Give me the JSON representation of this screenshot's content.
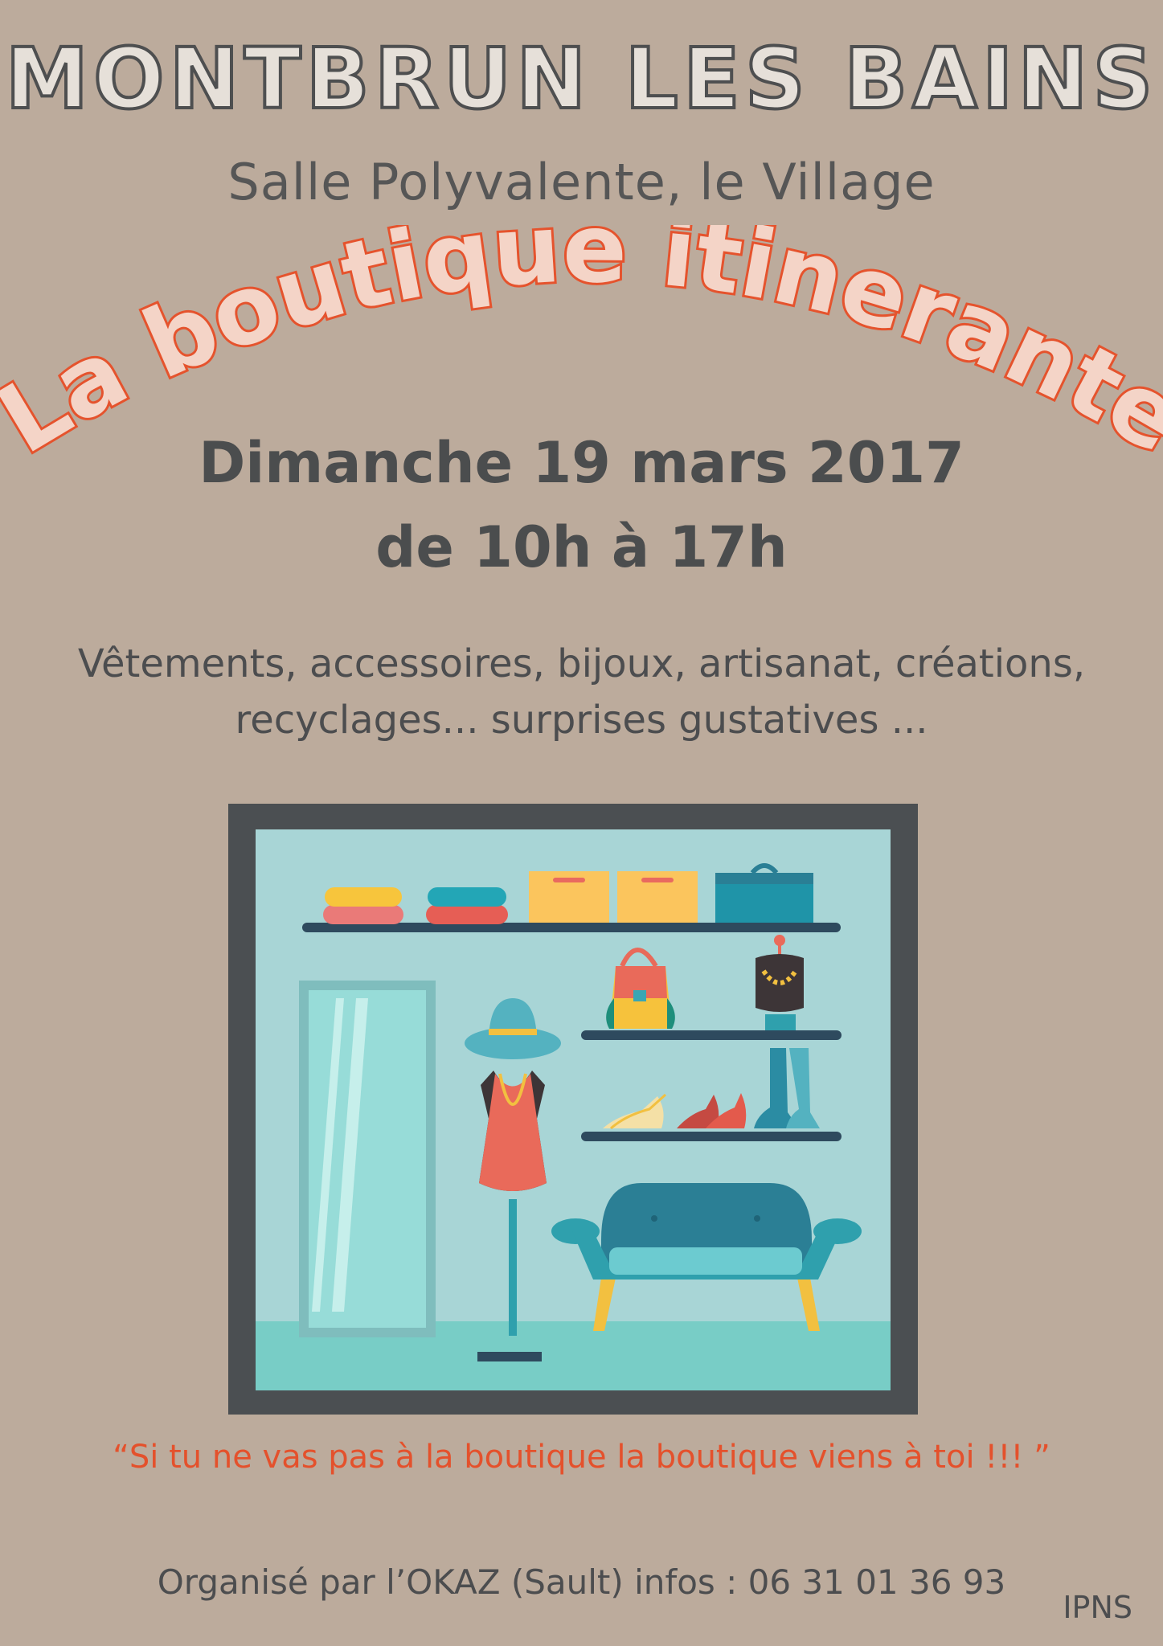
{
  "poster": {
    "town": "MONTBRUN LES BAINS",
    "venue": "Salle Polyvalente, le Village",
    "title": "La boutique itinerante",
    "date": "Dimanche 19 mars 2017",
    "hours": "de 10h à 17h",
    "description_line1": "Vêtements, accessoires, bijoux, artisanat, créations,",
    "description_line2": "recyclages... surprises gustatives ...",
    "quote": "“Si tu ne vas pas à la boutique la boutique viens à toi !!! ”",
    "organizer": "Organisé par l’OKAZ (Sault) infos : 06 31 01 36 93",
    "ipns": "IPNS"
  },
  "colors": {
    "background": "#bcab9c",
    "title_orange": "#e5532d",
    "dark_text": "#4b4d4e",
    "frame": "#4b4f52",
    "shop_wall": "#a8d5d6"
  }
}
